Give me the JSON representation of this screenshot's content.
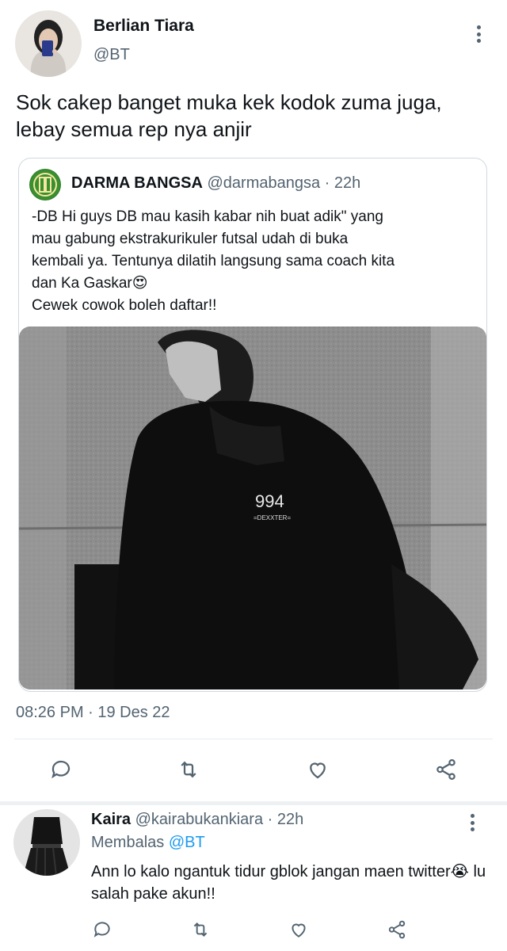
{
  "tweet": {
    "author_name": "Berlian Tiara",
    "author_handle": "@BT",
    "text": "Sok cakep banget muka kek kodok zuma juga, lebay semua rep nya anjir",
    "timestamp": "08:26 PM · 19 Des 22"
  },
  "quote": {
    "author_name": "DARMA BANGSA",
    "author_handle": "@darmabangsa",
    "time": "22h",
    "text_lines": [
      "-DB Hi guys DB mau kasih kabar nih buat adik\" yang",
      "mau gabung ekstrakurikuler futsal udah di buka",
      "kembali ya. Tentunya dilatih langsung sama coach kita",
      "dan Ka Gaskar😍",
      "Cewek cowok boleh daftar!!"
    ],
    "image_text": "994",
    "image_subtext": "=DEXXTER="
  },
  "reply": {
    "author_name": "Kaira",
    "author_handle": "@kairabukankiara",
    "time": "22h",
    "replying_prefix": "Membalas",
    "replying_to": "@BT",
    "text": "Ann lo kalo ngantuk tidur gblok jangan maen twitter😭 lu salah pake akun!!"
  },
  "icons": [
    "reply-icon",
    "retweet-icon",
    "like-icon",
    "share-icon",
    "more-icon"
  ],
  "colors": {
    "text": "#0f1419",
    "secondary": "#536471",
    "link": "#1d9bf0",
    "border": "#cfd9de"
  }
}
